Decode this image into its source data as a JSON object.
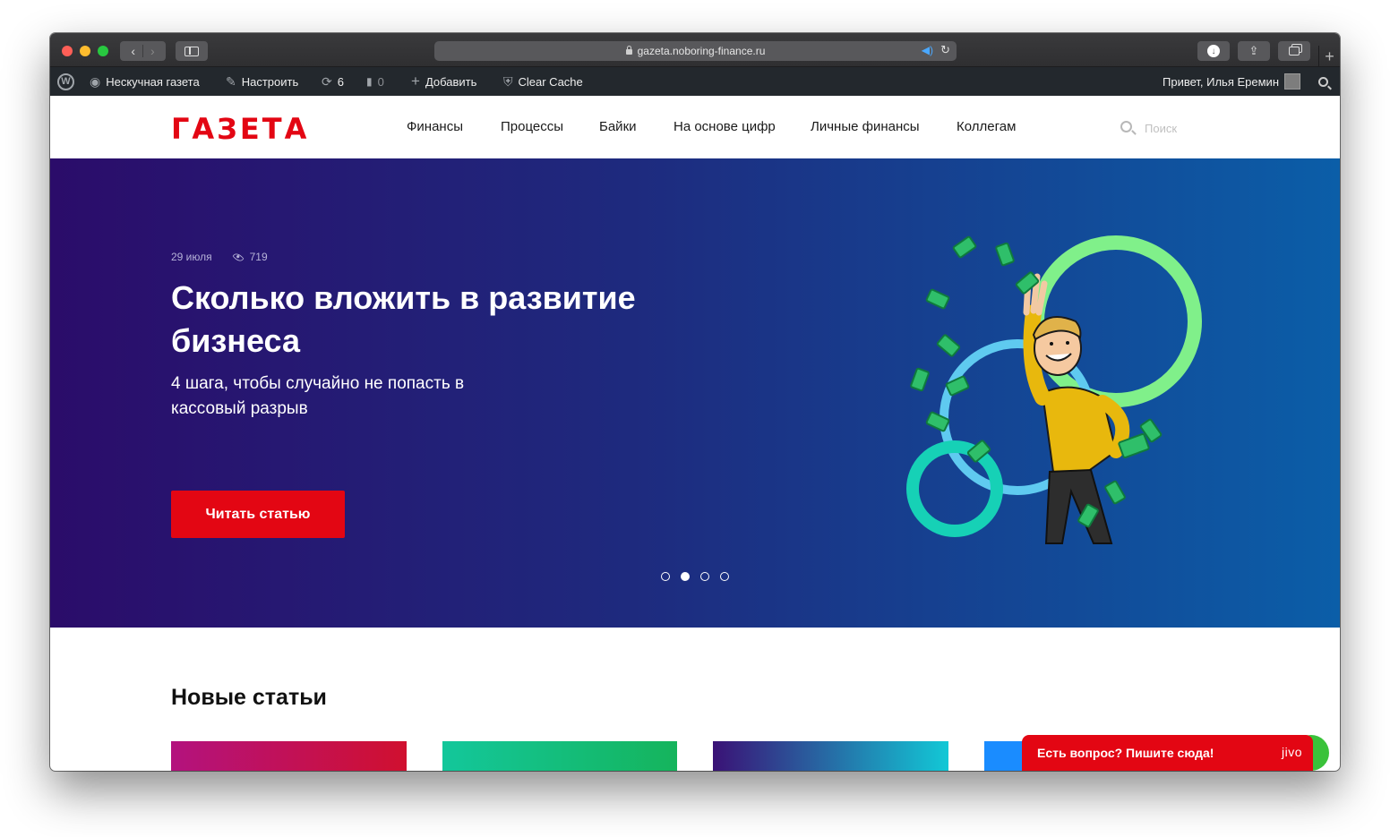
{
  "browser": {
    "url": "gazeta.noboring-finance.ru"
  },
  "adminbar": {
    "site_name": "Нескучная газета",
    "customize": "Настроить",
    "updates_count": "6",
    "comments_count": "0",
    "add_new": "Добавить",
    "clear_cache": "Clear Cache",
    "greeting": "Привет, Илья Еремин"
  },
  "header": {
    "logo": "ГАЗЕТА",
    "nav": [
      "Финансы",
      "Процессы",
      "Байки",
      "На основе цифр",
      "Личные финансы",
      "Коллегам"
    ],
    "search_placeholder": "Поиск"
  },
  "hero": {
    "date": "29 июля",
    "views": "719",
    "title": "Сколько вложить в развитие бизнеса",
    "subtitle": "4 шага, чтобы случайно не попасть в кассовый разрыв",
    "button": "Читать статью",
    "slides_total": 4,
    "active_slide": 2
  },
  "new_articles": {
    "title": "Новые статьи"
  },
  "jivo": {
    "label": "Есть вопрос? Пишите сюда!",
    "brand": "jivo"
  },
  "colors": {
    "brand_red": "#e30613",
    "hero_start": "#2b0c6a",
    "hero_end": "#0b5ea8",
    "adminbar": "#23282d"
  }
}
